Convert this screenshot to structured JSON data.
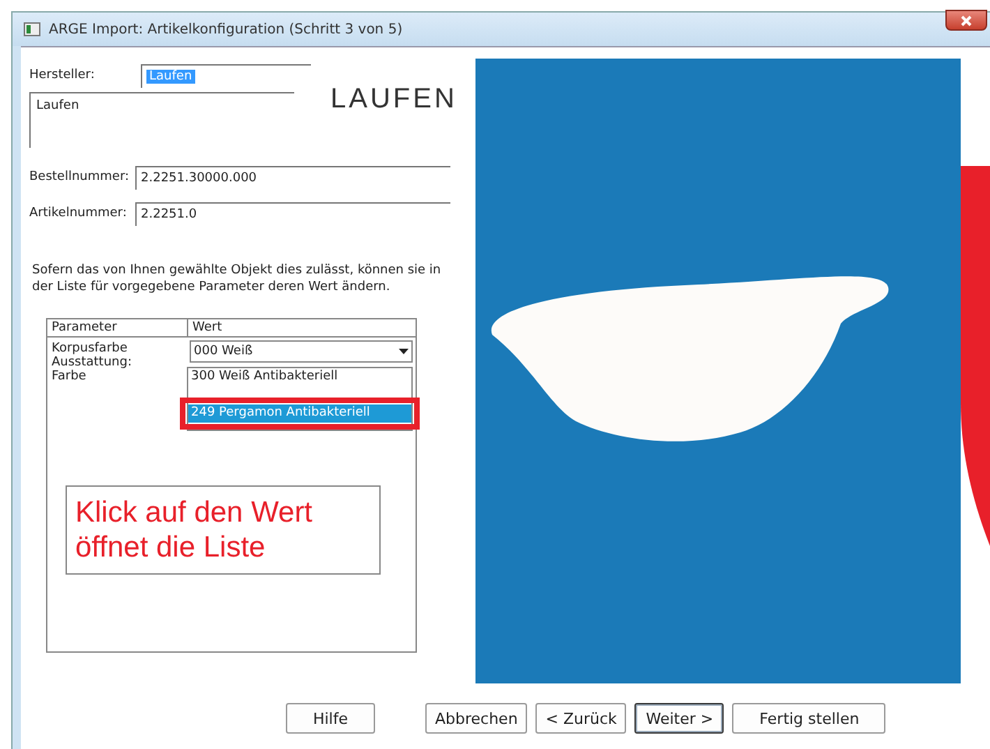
{
  "window": {
    "title": "ARGE Import: Artikelkonfiguration (Schritt 3 von 5)"
  },
  "fields": [
    {
      "kind": "select",
      "label": "Hersteller:",
      "value": "Laufen"
    },
    {
      "kind": "memo",
      "value": "Laufen"
    },
    {
      "kind": "text",
      "label": "Bestellnummer:",
      "value": "2.2251.30000.000"
    },
    {
      "kind": "text",
      "label": "Artikelnummer:",
      "value": "2.2251.0"
    }
  ],
  "logo": {
    "text": "LAUFEN"
  },
  "hint": "Sofern das von Ihnen gewählte Objekt dies zulässt, können sie in der Liste für vorgegebene Parameter deren Wert ändern.",
  "table": {
    "columns": [
      "Parameter",
      "Wert"
    ],
    "rows": [
      {
        "name": "Korpusfarbe",
        "value": "000 Weiß"
      },
      {
        "name": "Ausstattung:"
      },
      {
        "name": "Farbe"
      }
    ],
    "dropdown": [
      {
        "label": "300 Weiß Antibakteriell",
        "selected": false
      },
      {
        "label": "249 Pergamon Antibakteriell",
        "selected": true
      }
    ]
  },
  "annotation": {
    "text": "Klick auf den Wert öffnet die Liste"
  },
  "buttons": [
    {
      "label": "Hilfe",
      "default": false
    },
    {
      "label": "Abbrechen",
      "default": false
    },
    {
      "label": "< Zurück",
      "default": false
    },
    {
      "label": "Weiter >",
      "default": true
    },
    {
      "label": "Fertig stellen",
      "default": false
    }
  ]
}
